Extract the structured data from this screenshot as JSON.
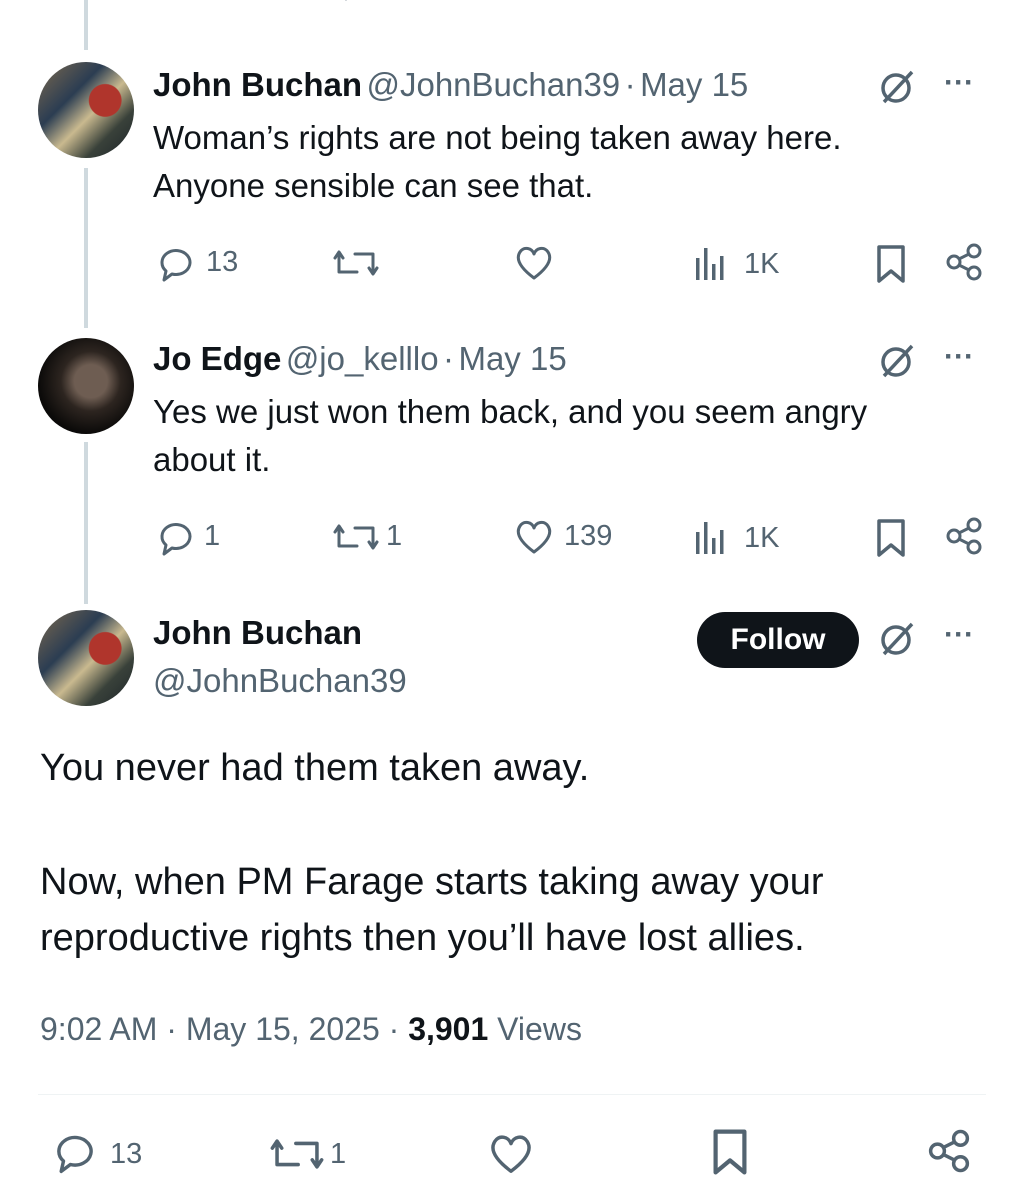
{
  "replies": [
    {
      "name": "John Buchan",
      "handle": "@JohnBuchan39",
      "date": "May 15",
      "line1": "Woman’s rights are not being taken away here.",
      "line2": "Anyone sensible can see that.",
      "replies": "13",
      "reposts": "",
      "likes": "",
      "views": "1K"
    },
    {
      "name": "Jo Edge",
      "handle": "@jo_kelllo",
      "date": "May 15",
      "line1": "Yes we just won them back, and you seem angry",
      "line2": "about it.",
      "replies": "1",
      "reposts": "1",
      "likes": "139",
      "views": "1K"
    }
  ],
  "main": {
    "name": "John Buchan",
    "handle": "@JohnBuchan39",
    "follow_label": "Follow",
    "para1": "You never had them taken away.",
    "para2_line1": "Now, when PM Farage starts taking away your",
    "para2_line2": "reproductive rights then you’ll have lost allies.",
    "time": "9:02 AM · May 15, 2025 · ",
    "views_count": "3,901",
    "views_label": " Views",
    "replies": "13",
    "reposts": "1"
  },
  "separator": "·",
  "more": "···"
}
